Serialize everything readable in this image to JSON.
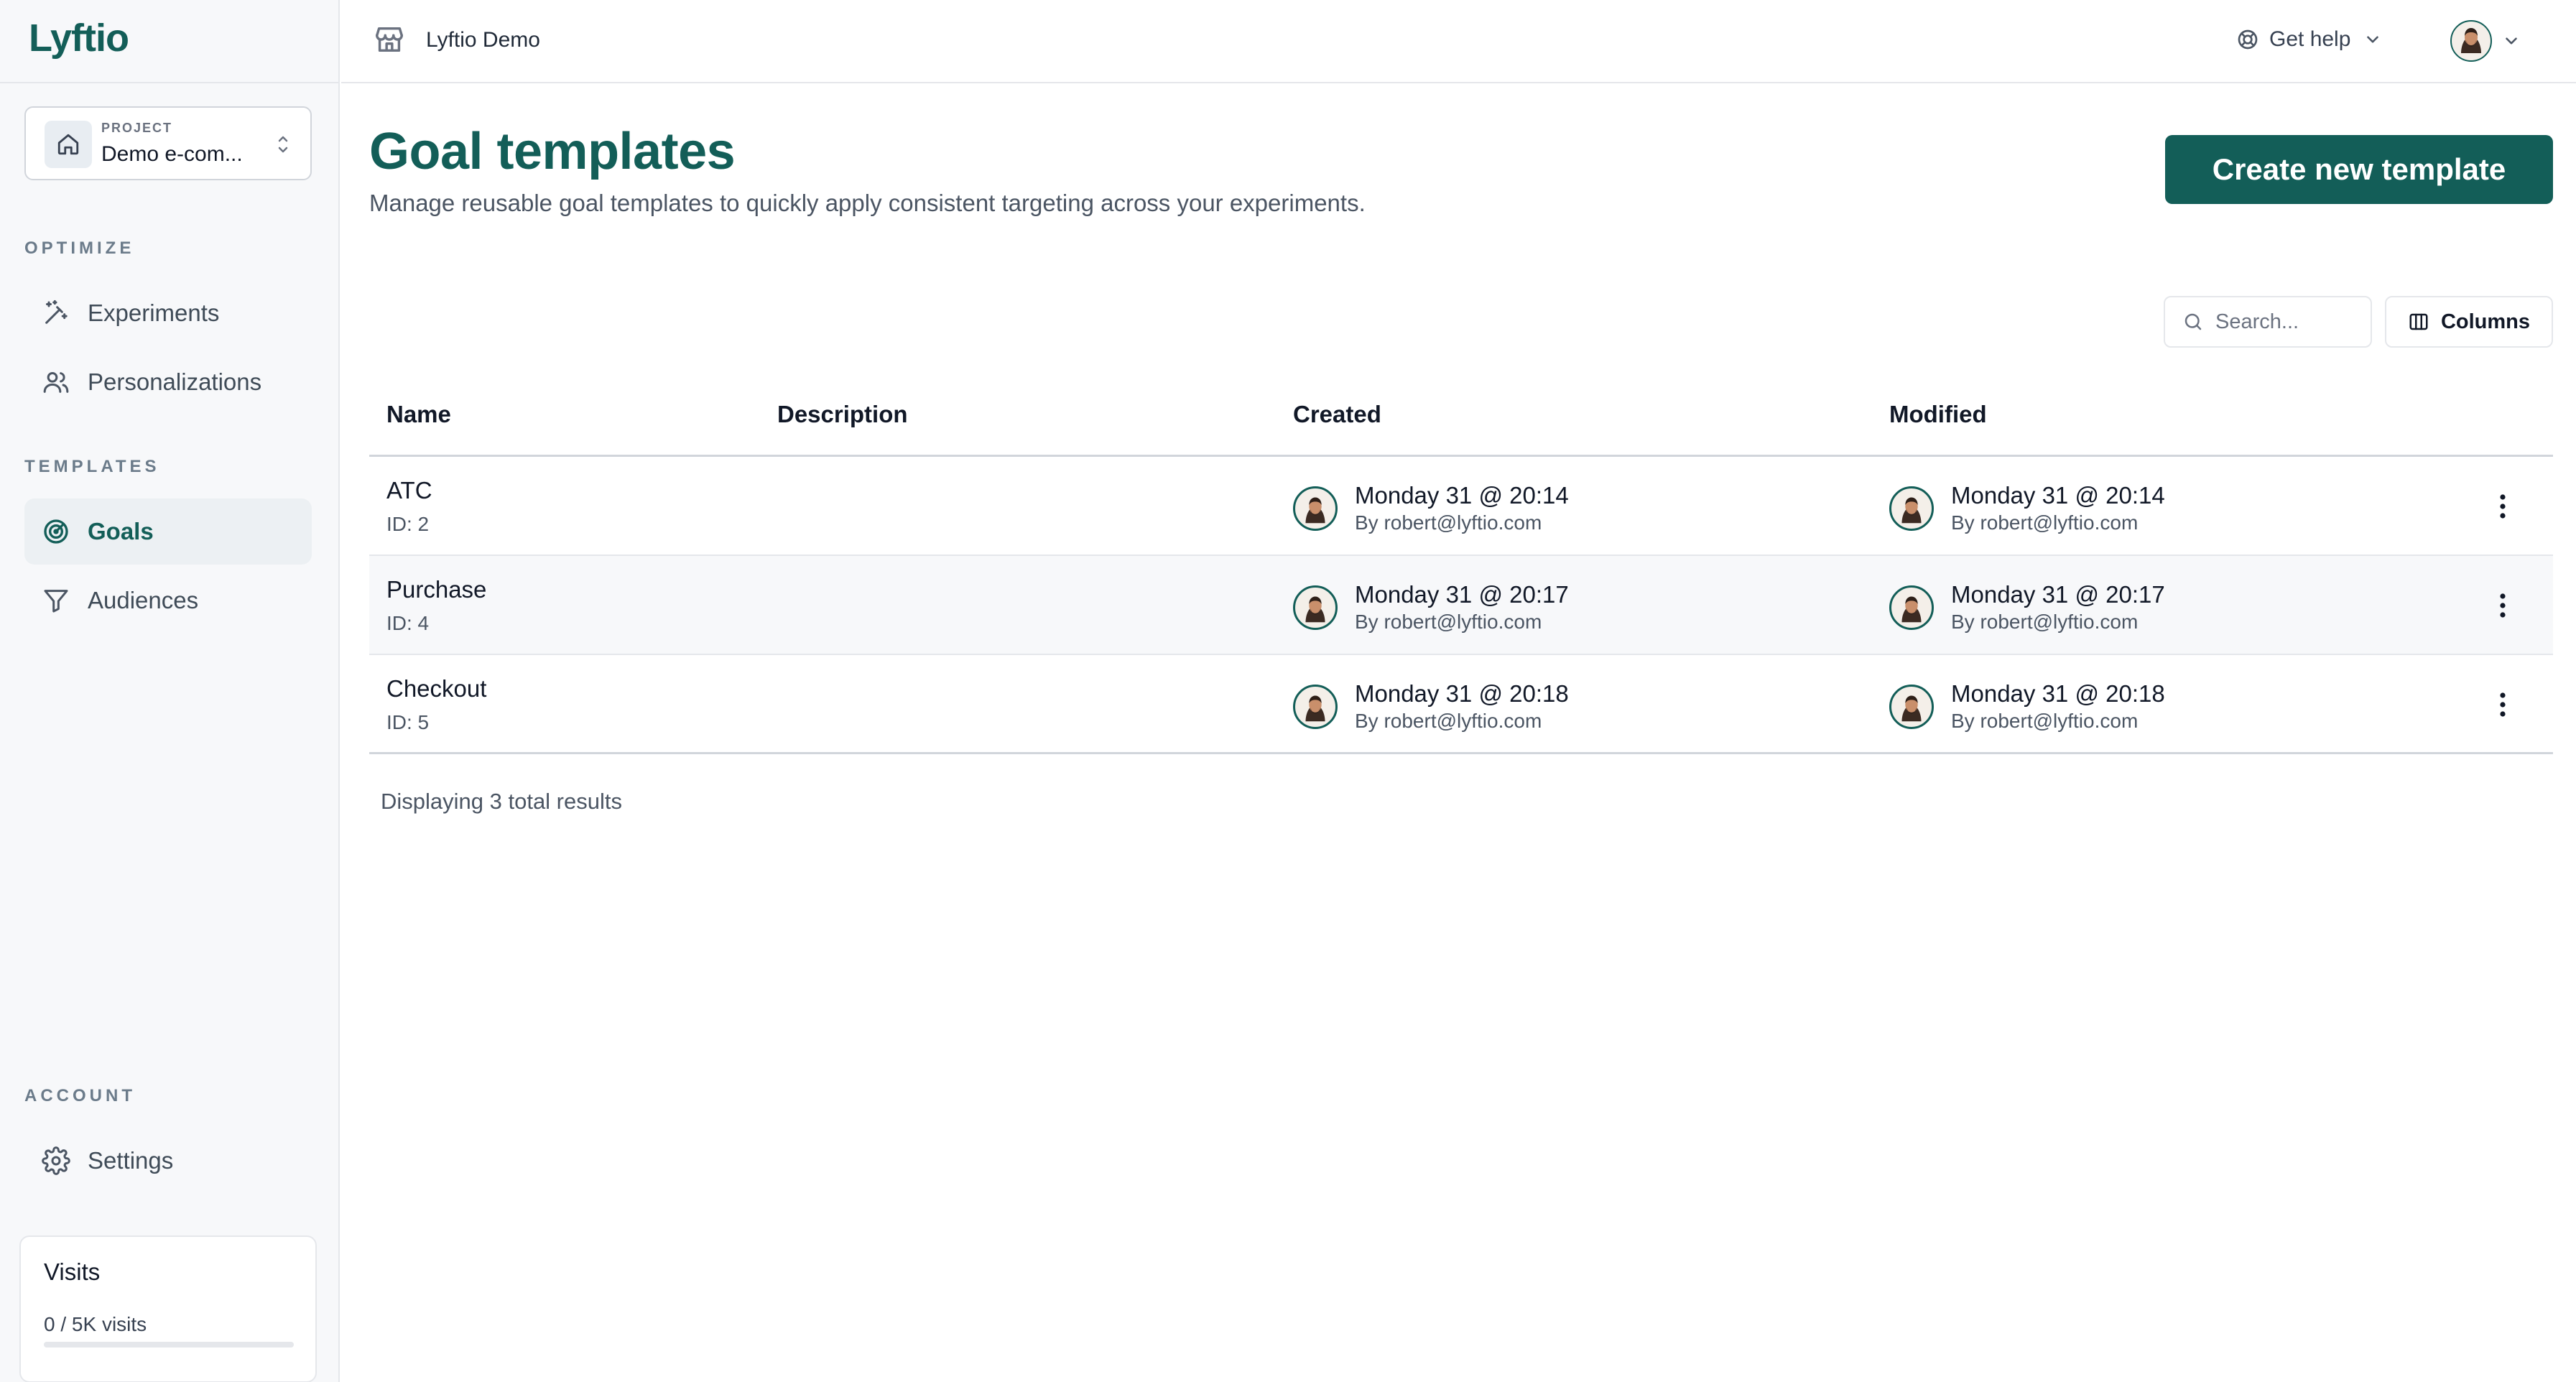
{
  "app": {
    "logo_text": "Lyftio"
  },
  "project": {
    "kicker": "PROJECT",
    "name": "Demo e-com..."
  },
  "sidebar": {
    "optimize_label": "OPTIMIZE",
    "optimize_items": [
      {
        "label": "Experiments",
        "icon": "magic-wand-icon"
      },
      {
        "label": "Personalizations",
        "icon": "users-icon"
      }
    ],
    "templates_label": "TEMPLATES",
    "templates_items": [
      {
        "label": "Goals",
        "icon": "target-icon",
        "active": true
      },
      {
        "label": "Audiences",
        "icon": "filter-icon"
      }
    ],
    "account_label": "ACCOUNT",
    "account_items": [
      {
        "label": "Settings",
        "icon": "gear-icon"
      }
    ]
  },
  "visits": {
    "title": "Visits",
    "count_text": "0 / 5K visits",
    "progress": 0.0
  },
  "topbar": {
    "store_name": "Lyftio Demo",
    "help_label": "Get help"
  },
  "header": {
    "title": "Goal templates",
    "subtitle": "Manage reusable goal templates to quickly apply consistent targeting across your experiments.",
    "create_button": "Create new template"
  },
  "toolbar": {
    "search_placeholder": "Search...",
    "columns_label": "Columns"
  },
  "table": {
    "columns": [
      "Name",
      "Description",
      "Created",
      "Modified"
    ],
    "rows": [
      {
        "name": "ATC",
        "id": "ID: 2",
        "created_date": "Monday 31 @ 20:14",
        "created_by": "By robert@lyftio.com",
        "modified_date": "Monday 31 @ 20:14",
        "modified_by": "By robert@lyftio.com"
      },
      {
        "name": "Purchase",
        "id": "ID: 4",
        "created_date": "Monday 31 @ 20:17",
        "created_by": "By robert@lyftio.com",
        "modified_date": "Monday 31 @ 20:17",
        "modified_by": "By robert@lyftio.com"
      },
      {
        "name": "Checkout",
        "id": "ID: 5",
        "created_date": "Monday 31 @ 20:18",
        "created_by": "By robert@lyftio.com",
        "modified_date": "Monday 31 @ 20:18",
        "modified_by": "By robert@lyftio.com"
      }
    ],
    "results_text": "Displaying 3 total results"
  },
  "colors": {
    "brand": "#135e58",
    "sidebar_bg": "#f7f8fa",
    "active_bg": "#ecf0f3"
  }
}
